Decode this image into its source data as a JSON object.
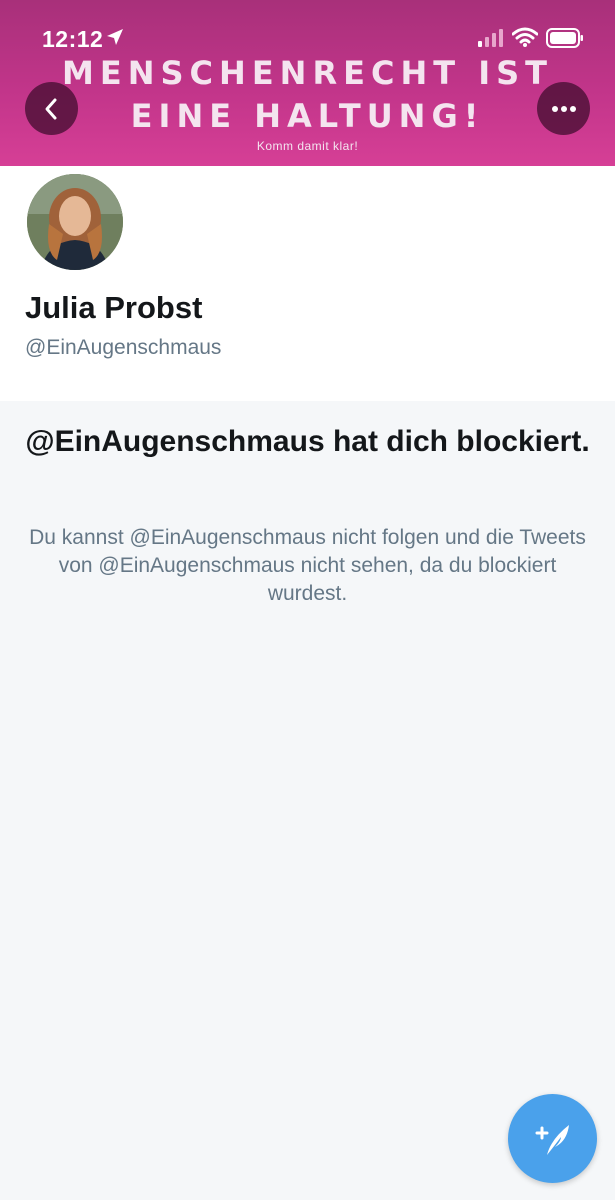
{
  "status_bar": {
    "time": "12:12"
  },
  "banner": {
    "line1": "MENSCHENRECHT IST",
    "line2": "EINE HALTUNG!",
    "subtitle": "Komm damit klar!"
  },
  "profile": {
    "display_name": "Julia Probst",
    "handle": "@EinAugenschmaus"
  },
  "blocked": {
    "title": "@EinAugenschmaus hat dich blockiert.",
    "description": "Du kannst @EinAugenschmaus nicht folgen und die Tweets von @EinAugenschmaus nicht sehen, da du blockiert wurdest."
  },
  "icons": {
    "back": "chevron-left-icon",
    "more": "more-horizontal-icon",
    "compose": "compose-tweet-icon",
    "signal": "cellular-signal-icon",
    "wifi": "wifi-icon",
    "battery": "battery-icon",
    "location": "location-arrow-icon"
  },
  "colors": {
    "header_pink": "#c2358a",
    "accent_blue": "#4aa1eb",
    "secondary_text": "#657786",
    "primary_text": "#14171a",
    "background": "#f5f7f9"
  }
}
